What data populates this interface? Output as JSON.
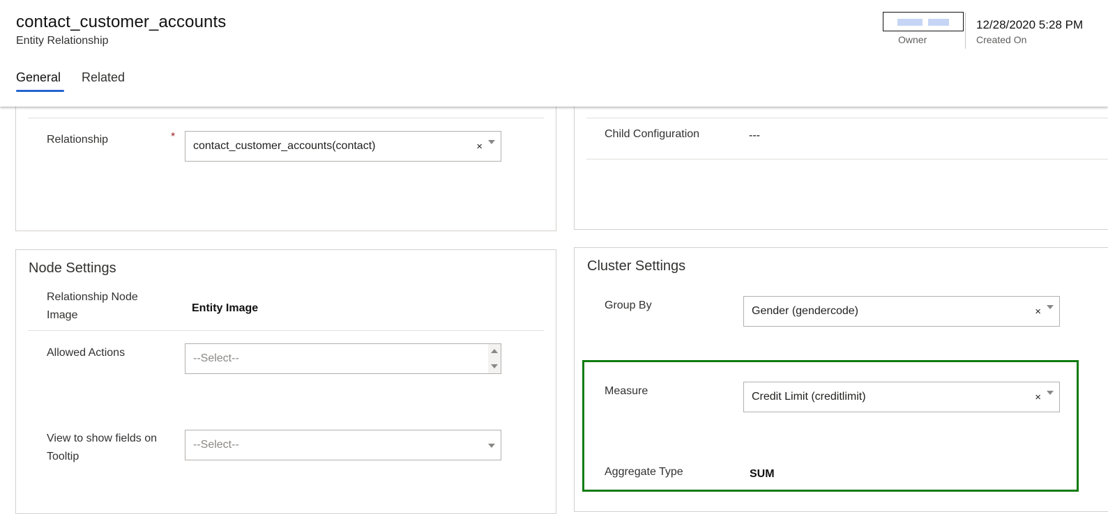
{
  "header": {
    "title": "contact_customer_accounts",
    "subtitle": "Entity Relationship",
    "owner_label": "Owner",
    "created_on_value": "12/28/2020 5:28 PM",
    "created_on_label": "Created On"
  },
  "tabs": [
    {
      "label": "General",
      "active": true
    },
    {
      "label": "Related",
      "active": false
    }
  ],
  "relationship": {
    "label": "Relationship",
    "required_marker": "*",
    "value": "contact_customer_accounts(contact)"
  },
  "child_configuration": {
    "label": "Child Configuration",
    "value": "---"
  },
  "node_settings": {
    "title": "Node Settings",
    "relationship_node_image": {
      "label_line1": "Relationship Node",
      "label_line2": "Image",
      "value": "Entity Image"
    },
    "allowed_actions": {
      "label": "Allowed Actions",
      "placeholder": "--Select--"
    },
    "tooltip_view": {
      "label_line1": "View to show fields on",
      "label_line2": "Tooltip",
      "placeholder": "--Select--"
    }
  },
  "cluster_settings": {
    "title": "Cluster Settings",
    "group_by": {
      "label": "Group By",
      "value": "Gender (gendercode)"
    },
    "measure": {
      "label": "Measure",
      "value": "Credit Limit (creditlimit)"
    },
    "aggregate_type": {
      "label": "Aggregate Type",
      "value": "SUM"
    }
  },
  "icons": {
    "clear": "×",
    "dropdown": "chevron-down-icon"
  },
  "colors": {
    "accent": "#2364d2",
    "required": "#a4262c",
    "highlight": "#107c10"
  }
}
